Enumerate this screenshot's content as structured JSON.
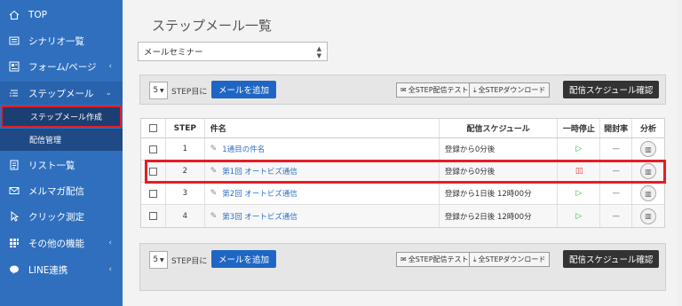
{
  "sidebar": {
    "items": [
      {
        "label": "TOP",
        "icon": "home-icon"
      },
      {
        "label": "シナリオ一覧",
        "icon": "list-icon"
      },
      {
        "label": "フォーム/ページ",
        "icon": "form-icon",
        "chevron": "‹"
      },
      {
        "label": "ステップメール",
        "icon": "steps-icon",
        "chevron": "⌄"
      },
      {
        "label": "リスト一覧",
        "icon": "document-icon"
      },
      {
        "label": "メルマガ配信",
        "icon": "mail-icon"
      },
      {
        "label": "クリック測定",
        "icon": "pointer-icon"
      },
      {
        "label": "その他の機能",
        "icon": "grid-icon",
        "chevron": "‹"
      },
      {
        "label": "LINE連携",
        "icon": "line-icon",
        "chevron": "‹"
      }
    ],
    "sub_items": [
      {
        "label": "ステップメール作成"
      },
      {
        "label": "配信管理"
      }
    ]
  },
  "main": {
    "title": "ステップメール一覧",
    "select_value": "メールセミナー"
  },
  "toolbar": {
    "step_count": "5",
    "step_label": "STEP目に",
    "add_label": "メールを追加",
    "test_label": "全STEP配信テスト",
    "download_label": "全STEPダウンロード",
    "schedule_label": "配信スケジュール確認"
  },
  "table": {
    "headers": {
      "step": "STEP",
      "title": "件名",
      "schedule": "配信スケジュール",
      "pause": "一時停止",
      "open_rate": "開封率",
      "analysis": "分析"
    },
    "rows": [
      {
        "step": "1",
        "title": "1通目の件名",
        "schedule": "登録から0分後",
        "paused": false,
        "open_rate": "—"
      },
      {
        "step": "2",
        "title": "第1回 オートビズ通信",
        "schedule": "登録から0分後",
        "paused": true,
        "open_rate": "—"
      },
      {
        "step": "3",
        "title": "第2回 オートビズ通信",
        "schedule": "登録から1日後 12時00分",
        "paused": false,
        "open_rate": "—"
      },
      {
        "step": "4",
        "title": "第3回 オートビズ通信",
        "schedule": "登録から2日後 12時00分",
        "paused": false,
        "open_rate": "—"
      }
    ]
  },
  "icons": {
    "play": "▷",
    "pause": "▯▯",
    "pen": "✎",
    "mail": "✉",
    "download": "⤓",
    "chart": "▥"
  },
  "colors": {
    "sidebar": "#2f6fbe",
    "accent": "#1f66c4",
    "highlight": "#e41e26",
    "dark_button": "#333333"
  }
}
